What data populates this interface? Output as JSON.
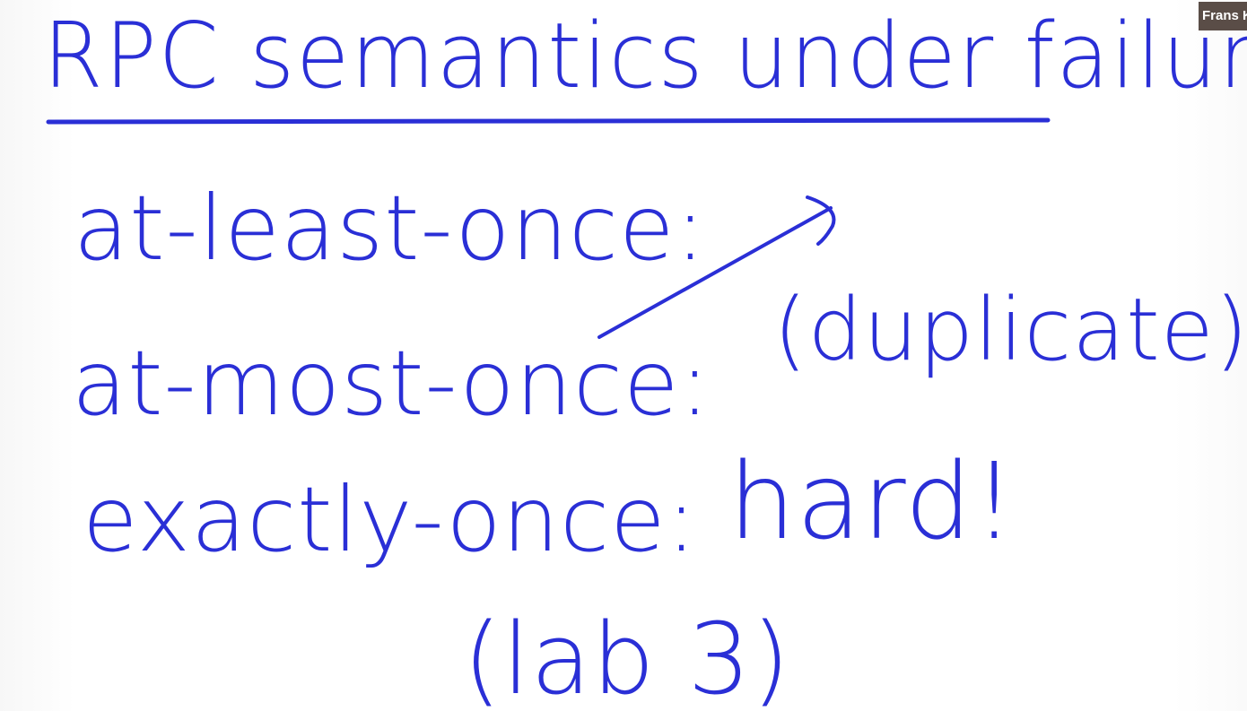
{
  "whiteboard": {
    "title": "RPC semantics under failures",
    "items": [
      "at-least-once:",
      "at-most-once:",
      "exactly-once:"
    ],
    "duplicate_note": "(duplicate)",
    "exactly_once_note": "hard!",
    "lab_note": "(lab 3)"
  },
  "participant": {
    "name": "Frans K"
  },
  "colors": {
    "ink": "#2a2fd6",
    "background": "#ffffff",
    "name_tag_bg": "#5a4d47"
  }
}
